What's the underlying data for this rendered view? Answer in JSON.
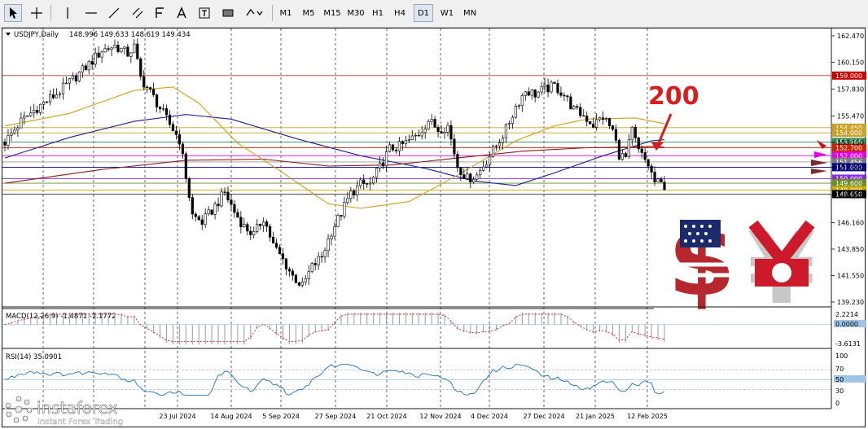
{
  "toolbar": {
    "tools": [
      "cursor-tool",
      "crosshair-tool",
      "vertical-line-tool",
      "horizontal-line-tool",
      "trendline-tool",
      "equidistant-channel-tool",
      "fibonacci-tool",
      "text-tool",
      "text-label-tool",
      "shapes-tool",
      "arrows-tool"
    ],
    "timeframes": [
      "M1",
      "M5",
      "M15",
      "M30",
      "H1",
      "H4",
      "D1",
      "W1",
      "MN"
    ],
    "active_timeframe": "D1"
  },
  "chart_data": {
    "type": "candlestick",
    "title": "USDJPY,Daily",
    "ohlc_header": "148.996 149.633 148.619 149.434",
    "price_axis_ticks": [
      "162.470",
      "160.150",
      "157.830",
      "155.470",
      "153.150",
      "151.000",
      "148.510",
      "146.160",
      "143.850",
      "141.550",
      "139.230"
    ],
    "date_labels": [
      "23 Jul 2024",
      "14 Aug 2024",
      "5 Sep 2024",
      "27 Sep 2024",
      "21 Oct 2024",
      "12 Nov 2024",
      "4 Dec 2024",
      "27 Dec 2024",
      "21 Jan 2025",
      "12 Feb 2025"
    ],
    "ylim": [
      139.2,
      163.2
    ],
    "price_path": [
      {
        "t": 0,
        "p": 153.2
      },
      {
        "t": 5,
        "p": 155.0
      },
      {
        "t": 10,
        "p": 156.2
      },
      {
        "t": 16,
        "p": 157.4
      },
      {
        "t": 20,
        "p": 158.4
      },
      {
        "t": 26,
        "p": 160.0
      },
      {
        "t": 30,
        "p": 161.2
      },
      {
        "t": 34,
        "p": 161.6
      },
      {
        "t": 38,
        "p": 160.9
      },
      {
        "t": 40,
        "p": 161.5
      },
      {
        "t": 42,
        "p": 158.8
      },
      {
        "t": 46,
        "p": 157.1
      },
      {
        "t": 50,
        "p": 155.2
      },
      {
        "t": 54,
        "p": 153.4
      },
      {
        "t": 56,
        "p": 150.2
      },
      {
        "t": 58,
        "p": 146.8
      },
      {
        "t": 61,
        "p": 146.2
      },
      {
        "t": 64,
        "p": 147.2
      },
      {
        "t": 68,
        "p": 148.8
      },
      {
        "t": 71,
        "p": 147.1
      },
      {
        "t": 74,
        "p": 145.8
      },
      {
        "t": 77,
        "p": 145.1
      },
      {
        "t": 80,
        "p": 146.6
      },
      {
        "t": 83,
        "p": 144.2
      },
      {
        "t": 86,
        "p": 142.9
      },
      {
        "t": 89,
        "p": 141.5
      },
      {
        "t": 92,
        "p": 140.6
      },
      {
        "t": 95,
        "p": 142.3
      },
      {
        "t": 98,
        "p": 143.2
      },
      {
        "t": 101,
        "p": 145.4
      },
      {
        "t": 104,
        "p": 147.0
      },
      {
        "t": 107,
        "p": 148.7
      },
      {
        "t": 110,
        "p": 149.5
      },
      {
        "t": 113,
        "p": 149.5
      },
      {
        "t": 116,
        "p": 151.0
      },
      {
        "t": 119,
        "p": 152.6
      },
      {
        "t": 122,
        "p": 152.8
      },
      {
        "t": 125,
        "p": 153.3
      },
      {
        "t": 128,
        "p": 153.9
      },
      {
        "t": 131,
        "p": 155.1
      },
      {
        "t": 134,
        "p": 154.3
      },
      {
        "t": 137,
        "p": 154.6
      },
      {
        "t": 140,
        "p": 151.1
      },
      {
        "t": 143,
        "p": 150.0
      },
      {
        "t": 146,
        "p": 150.3
      },
      {
        "t": 149,
        "p": 151.6
      },
      {
        "t": 152,
        "p": 152.9
      },
      {
        "t": 155,
        "p": 154.3
      },
      {
        "t": 158,
        "p": 156.3
      },
      {
        "t": 161,
        "p": 157.7
      },
      {
        "t": 164,
        "p": 157.4
      },
      {
        "t": 167,
        "p": 157.8
      },
      {
        "t": 170,
        "p": 158.1
      },
      {
        "t": 173,
        "p": 157.3
      },
      {
        "t": 176,
        "p": 156.0
      },
      {
        "t": 179,
        "p": 155.5
      },
      {
        "t": 182,
        "p": 154.7
      },
      {
        "t": 185,
        "p": 155.4
      },
      {
        "t": 188,
        "p": 154.2
      },
      {
        "t": 190,
        "p": 152.1
      },
      {
        "t": 192,
        "p": 151.8
      },
      {
        "t": 194,
        "p": 154.2
      },
      {
        "t": 196,
        "p": 152.4
      },
      {
        "t": 199,
        "p": 151.2
      },
      {
        "t": 201,
        "p": 149.7
      },
      {
        "t": 204,
        "p": 149.4
      }
    ],
    "horizontal_levels": [
      {
        "price": 159.0,
        "color": "#c0392b",
        "label": "159.000",
        "label_bg": "#cc0000",
        "label_fg": "#ffffff"
      },
      {
        "price": 154.45,
        "color": "#c9a227",
        "label": "154.450",
        "label_bg": "#c9a227",
        "label_fg": "#ffffff"
      },
      {
        "price": 154.0,
        "color": "#c9a227",
        "label": "154.000",
        "label_bg": "#c9a227",
        "label_fg": "#ffffff"
      },
      {
        "price": 153.2,
        "color": "#2e8b57",
        "label": "153.200",
        "label_bg": "#2e8b57",
        "label_fg": "#ffffff"
      },
      {
        "price": 152.7,
        "color": "#cc2200",
        "label": "152.700",
        "label_bg": "#cc2200",
        "label_fg": "#ffffff"
      },
      {
        "price": 152.0,
        "color": "#e600e6",
        "label": "152.000",
        "label_bg": "#e600e6",
        "label_fg": "#ffffff"
      },
      {
        "price": 151.456,
        "color": "#999999",
        "label": "151.456",
        "label_bg": "#7a7a7a",
        "label_fg": "#ffffff"
      },
      {
        "price": 151.0,
        "color": "#00008b",
        "label": "151.000",
        "label_bg": "#00008b",
        "label_fg": "#ffffff"
      },
      {
        "price": 150.0,
        "color": "#8a2be2",
        "label": "150.000",
        "label_bg": "#8a2be2",
        "label_fg": "#ffffff"
      },
      {
        "price": 149.6,
        "color": "#6b8e23",
        "label": "149.600",
        "label_bg": "#6b8e23",
        "label_fg": "#ffffff"
      },
      {
        "price": 149.0,
        "color": "#ccaa00",
        "label": "149.000",
        "label_bg": "#ccaa00",
        "label_fg": "#ffffff"
      },
      {
        "price": 148.65,
        "color": "#333333",
        "label": "148.650",
        "label_bg": "#000000",
        "label_fg": "#ffffff"
      }
    ],
    "moving_averages": [
      {
        "color": "#1f1f9e",
        "points": [
          {
            "t": 0,
            "p": 151.8
          },
          {
            "t": 20,
            "p": 153.6
          },
          {
            "t": 40,
            "p": 155.0
          },
          {
            "t": 56,
            "p": 155.6
          },
          {
            "t": 70,
            "p": 155.2
          },
          {
            "t": 90,
            "p": 153.5
          },
          {
            "t": 110,
            "p": 152.0
          },
          {
            "t": 130,
            "p": 150.9
          },
          {
            "t": 145,
            "p": 149.8
          },
          {
            "t": 158,
            "p": 149.4
          },
          {
            "t": 170,
            "p": 150.5
          },
          {
            "t": 185,
            "p": 152.0
          },
          {
            "t": 200,
            "p": 153.3
          },
          {
            "t": 204,
            "p": 153.4
          }
        ]
      },
      {
        "color": "#8b1a1a",
        "points": [
          {
            "t": 0,
            "p": 149.6
          },
          {
            "t": 30,
            "p": 150.8
          },
          {
            "t": 56,
            "p": 151.6
          },
          {
            "t": 80,
            "p": 151.7
          },
          {
            "t": 100,
            "p": 151.1
          },
          {
            "t": 120,
            "p": 151.2
          },
          {
            "t": 140,
            "p": 151.8
          },
          {
            "t": 160,
            "p": 152.4
          },
          {
            "t": 180,
            "p": 152.7
          },
          {
            "t": 200,
            "p": 152.8
          },
          {
            "t": 204,
            "p": 152.75
          }
        ]
      },
      {
        "color": "#d4a017",
        "points": [
          {
            "t": 0,
            "p": 154.6
          },
          {
            "t": 20,
            "p": 155.7
          },
          {
            "t": 40,
            "p": 157.7
          },
          {
            "t": 52,
            "p": 158.0
          },
          {
            "t": 60,
            "p": 156.6
          },
          {
            "t": 72,
            "p": 153.1
          },
          {
            "t": 85,
            "p": 150.7
          },
          {
            "t": 100,
            "p": 147.8
          },
          {
            "t": 110,
            "p": 147.4
          },
          {
            "t": 125,
            "p": 148.0
          },
          {
            "t": 140,
            "p": 150.3
          },
          {
            "t": 158,
            "p": 153.3
          },
          {
            "t": 170,
            "p": 154.6
          },
          {
            "t": 180,
            "p": 155.2
          },
          {
            "t": 195,
            "p": 155.3
          },
          {
            "t": 204,
            "p": 154.8
          }
        ]
      }
    ],
    "annotation": {
      "text": "200",
      "color": "#d62020"
    },
    "macd": {
      "label": "MACD(12,26,9) -1.4871 -1.1772",
      "ticks": [
        "2.2214",
        "0.0000",
        "-3.6131"
      ],
      "ylim": [
        -4.0,
        2.6
      ]
    },
    "rsi": {
      "label": "RSI(14) 35.0901",
      "ticks": [
        "100",
        "70",
        "50",
        "30",
        "0"
      ],
      "levels": [
        70,
        50,
        30
      ]
    },
    "watermark": {
      "brand": "instaforex",
      "tagline": "Instant Forex Trading"
    }
  }
}
